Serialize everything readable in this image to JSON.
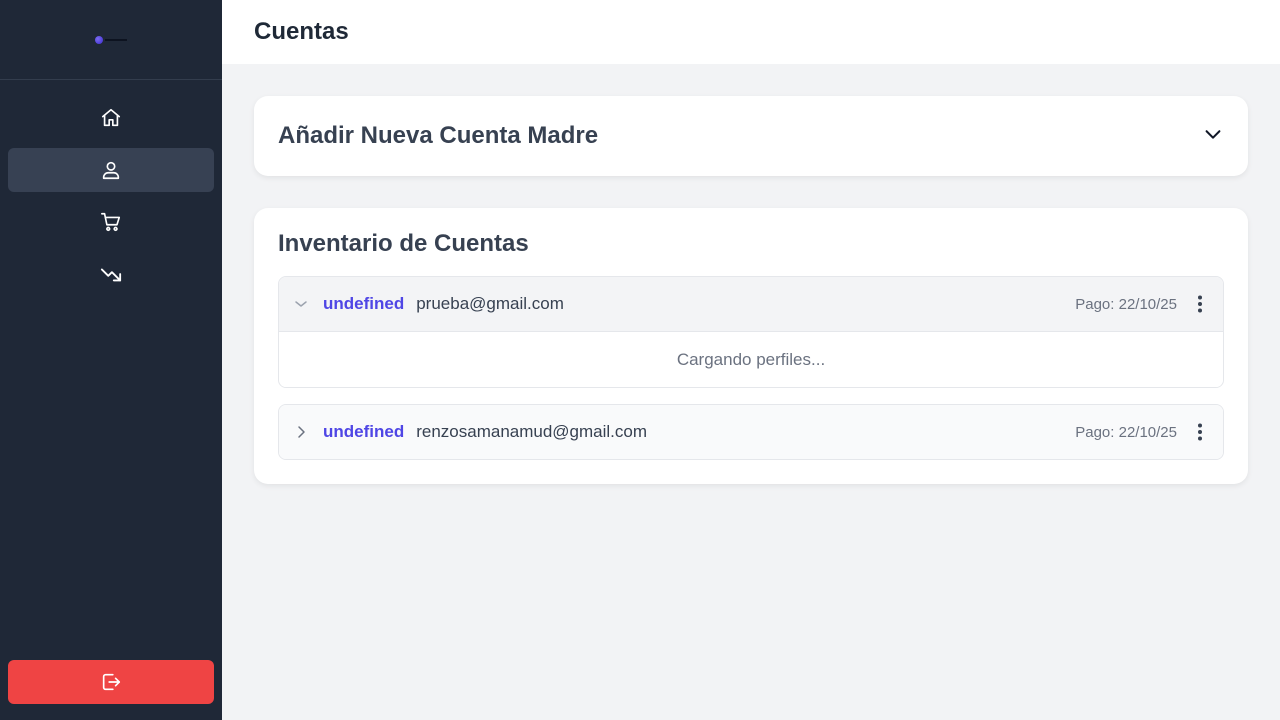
{
  "header": {
    "title": "Cuentas"
  },
  "sidebar": {
    "nav": [
      {
        "icon": "home-icon",
        "active": false
      },
      {
        "icon": "user-icon",
        "active": true
      },
      {
        "icon": "cart-icon",
        "active": false
      },
      {
        "icon": "trending-down-icon",
        "active": false
      }
    ],
    "logout_icon": "logout-icon"
  },
  "add_card": {
    "title": "Añadir Nueva Cuenta Madre"
  },
  "inventory": {
    "title": "Inventario de Cuentas",
    "accounts": [
      {
        "name": "undefined",
        "email": "prueba@gmail.com",
        "payment": "Pago: 22/10/25",
        "expanded": true,
        "body_text": "Cargando perfiles..."
      },
      {
        "name": "undefined",
        "email": "renzosamanamud@gmail.com",
        "payment": "Pago: 22/10/25",
        "expanded": false
      }
    ]
  },
  "colors": {
    "sidebar_bg": "#1f2837",
    "active_nav": "#374153",
    "logout_bg": "#ef4444",
    "accent": "#4f46e5"
  }
}
